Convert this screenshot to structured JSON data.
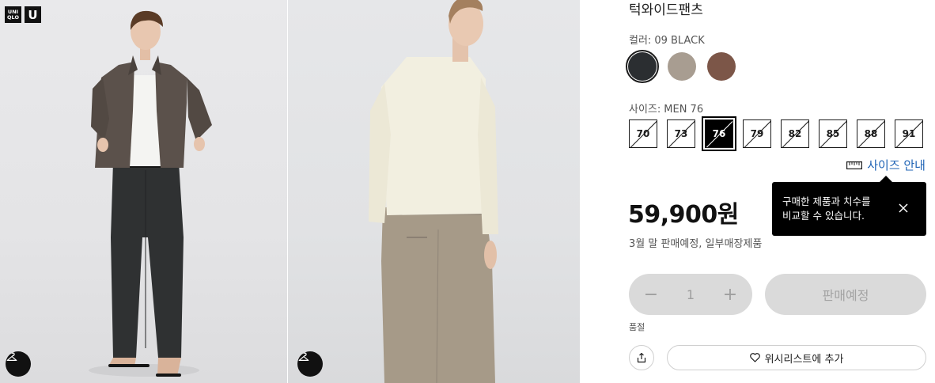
{
  "product": {
    "title": "턱와이드팬츠",
    "color_label": "컬러:",
    "color_value": "09 BLACK",
    "size_label": "사이즈:",
    "size_value": "MEN 76",
    "price": "59,900원",
    "status": "3월 말 판매예정,  일부매장제품"
  },
  "colors": [
    {
      "name": "black",
      "hex": "#2b2e31",
      "selected": true
    },
    {
      "name": "beige",
      "hex": "#a89d91",
      "selected": false
    },
    {
      "name": "brown",
      "hex": "#7c5648",
      "selected": false
    }
  ],
  "sizes": [
    "70",
    "73",
    "76",
    "79",
    "82",
    "85",
    "88",
    "91"
  ],
  "selected_size": "76",
  "size_guide": {
    "label": "사이즈 안내",
    "icon": "ruler-icon"
  },
  "tooltip": {
    "line1": "구매한 제품과 치수를",
    "line2": "비교할 수 있습니다.",
    "close_icon": "close-icon"
  },
  "quantity": {
    "minus": "−",
    "value": "1",
    "plus": "+"
  },
  "buttons": {
    "cart": "판매예정",
    "wishlist": "위시리스트에 추가"
  },
  "soldout_label": "품절",
  "logo": {
    "line1": "UNI",
    "line2": "QLO",
    "letter": "U"
  },
  "icons": {
    "hanger": "hanger-icon",
    "share": "share-icon",
    "heart": "heart-icon"
  }
}
